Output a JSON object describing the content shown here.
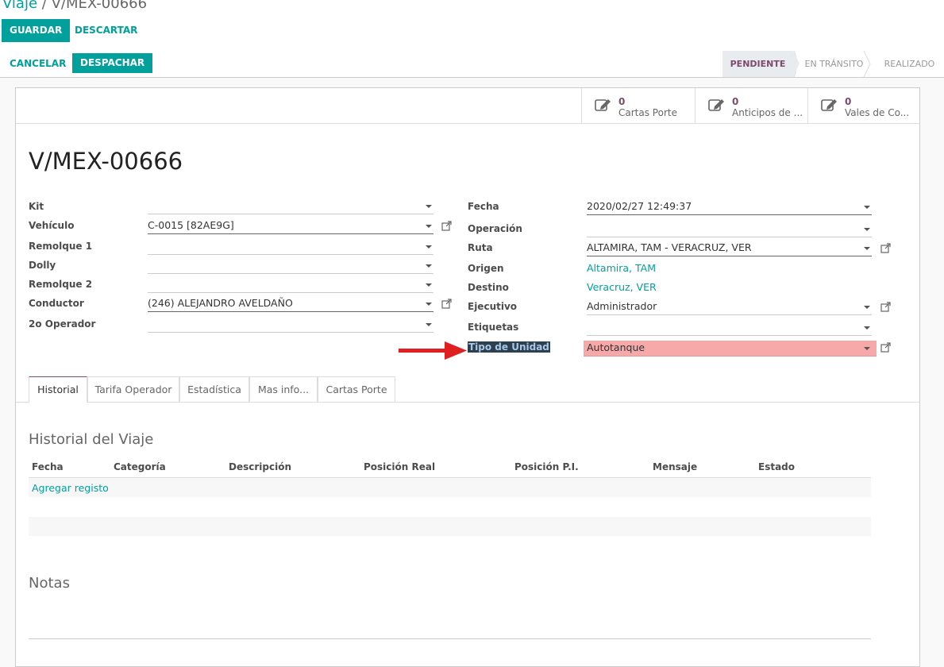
{
  "breadcrumb": {
    "parent": "Viaje",
    "separator": "/",
    "current": "V/MEX-00666"
  },
  "toolbar": {
    "save": "GUARDAR",
    "discard": "DESCARTAR"
  },
  "actions": {
    "cancel": "CANCELAR",
    "dispatch": "DESPACHAR"
  },
  "stages": [
    "PENDIENTE",
    "EN TRÁNSITO",
    "REALIZADO"
  ],
  "smart_buttons": [
    {
      "count": "0",
      "label": "Cartas Porte"
    },
    {
      "count": "0",
      "label": "Anticipos de ..."
    },
    {
      "count": "0",
      "label": "Vales de Co..."
    }
  ],
  "record_title": "V/MEX-00666",
  "left_fields": [
    {
      "label": "Kit",
      "value": ""
    },
    {
      "label": "Vehículo",
      "value": "C-0015 [82AE9G]"
    },
    {
      "label": "Remolque 1",
      "value": ""
    },
    {
      "label": "Dolly",
      "value": ""
    },
    {
      "label": "Remolque 2",
      "value": ""
    },
    {
      "label": "Conductor",
      "value": "(246) ALEJANDRO AVELDAÑO"
    },
    {
      "label": "2o Operador",
      "value": ""
    }
  ],
  "right_fields": {
    "fecha": {
      "label": "Fecha",
      "value": "2020/02/27 12:49:37"
    },
    "operacion": {
      "label": "Operación",
      "value": ""
    },
    "ruta": {
      "label": "Ruta",
      "value": "ALTAMIRA, TAM - VERACRUZ, VER"
    },
    "origen": {
      "label": "Origen",
      "value": "Altamira, TAM"
    },
    "destino": {
      "label": "Destino",
      "value": "Veracruz, VER"
    },
    "ejecutivo": {
      "label": "Ejecutivo",
      "value": "Administrador"
    },
    "etiquetas": {
      "label": "Etiquetas",
      "value": ""
    },
    "tipo_unidad": {
      "label": "Tipo de Unidad",
      "value": "Autotanque"
    }
  },
  "tabs": [
    "Historial",
    "Tarifa Operador",
    "Estadística",
    "Mas info...",
    "Cartas Porte"
  ],
  "history": {
    "title": "Historial del Viaje",
    "columns": [
      "Fecha",
      "Categoría",
      "Descripción",
      "Posición Real",
      "Posición P.I.",
      "Mensaje",
      "Estado"
    ],
    "add_row": "Agregar registo"
  },
  "notes_title": "Notas",
  "colors": {
    "accent": "#00a09d",
    "stage_active": "#7c4a6f",
    "highlight_field": "#f7a8a8",
    "arrow": "#e02020"
  }
}
